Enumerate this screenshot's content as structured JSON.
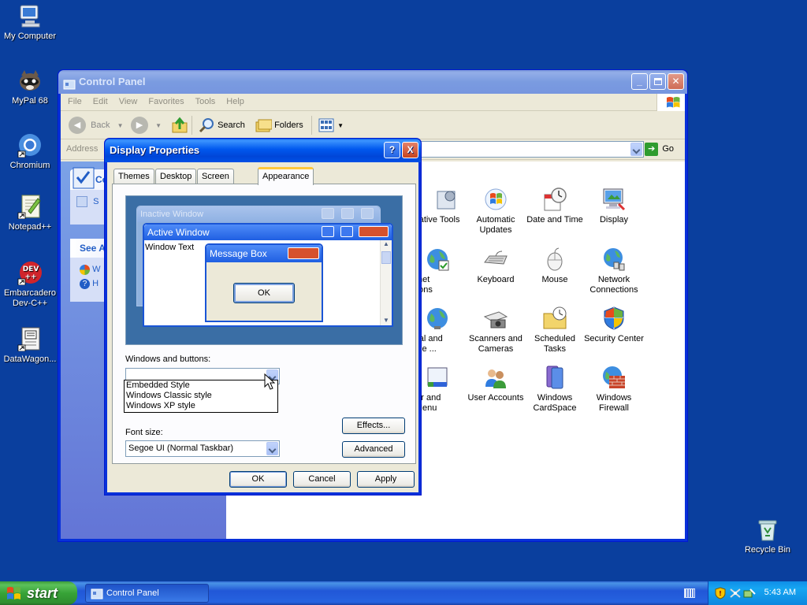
{
  "desktop": {
    "icons": [
      {
        "label": "My Computer"
      },
      {
        "label": "MyPal 68"
      },
      {
        "label": "Chromium"
      },
      {
        "label": "Notepad++"
      },
      {
        "label": "Embarcadero Dev-C++"
      },
      {
        "label": "DataWagon..."
      },
      {
        "label": "Recycle Bin"
      }
    ]
  },
  "control_panel": {
    "title": "Control Panel",
    "menu": [
      "File",
      "Edit",
      "View",
      "Favorites",
      "Tools",
      "Help"
    ],
    "toolbar": {
      "back": "Back",
      "search": "Search",
      "folders": "Folders"
    },
    "address_label": "Address",
    "go_label": "Go",
    "side": {
      "box1_title": "Co",
      "box1_item": "S",
      "box2_title": "See A",
      "box2_item1": "W",
      "box2_item2": "H"
    },
    "items": [
      {
        "label": "inistrative Tools"
      },
      {
        "label": "Automatic Updates"
      },
      {
        "label": "Date and Time"
      },
      {
        "label": "Display"
      },
      {
        "label": "nternet Options"
      },
      {
        "label": "Keyboard"
      },
      {
        "label": "Mouse"
      },
      {
        "label": "Network Connections"
      },
      {
        "label": "gional and guage ..."
      },
      {
        "label": "Scanners and Cameras"
      },
      {
        "label": "Scheduled Tasks"
      },
      {
        "label": "Security Center"
      },
      {
        "label": "skbar and art Menu"
      },
      {
        "label": "User Accounts"
      },
      {
        "label": "Windows CardSpace"
      },
      {
        "label": "Windows Firewall"
      }
    ]
  },
  "dialog": {
    "title": "Display Properties",
    "help_glyph": "?",
    "close_glyph": "X",
    "tabs": [
      "Themes",
      "Desktop",
      "Screen Saver",
      "Appearance"
    ],
    "preview": {
      "inactive_title": "Inactive Window",
      "active_title": "Active Window",
      "window_text": "Window Text",
      "msgbox_title": "Message Box",
      "msgbox_ok": "OK"
    },
    "windows_buttons_label": "Windows and buttons:",
    "windows_buttons_value": "",
    "dropdown_options": [
      "Embedded Style",
      "Windows Classic style",
      "Windows XP style"
    ],
    "font_size_label": "Font size:",
    "font_size_value": "Segoe UI (Normal Taskbar)",
    "effects_button": "Effects...",
    "advanced_button": "Advanced",
    "ok_button": "OK",
    "cancel_button": "Cancel",
    "apply_button": "Apply"
  },
  "taskbar": {
    "start_label": "start",
    "task_label": "Control Panel",
    "clock": "5:43 AM"
  }
}
